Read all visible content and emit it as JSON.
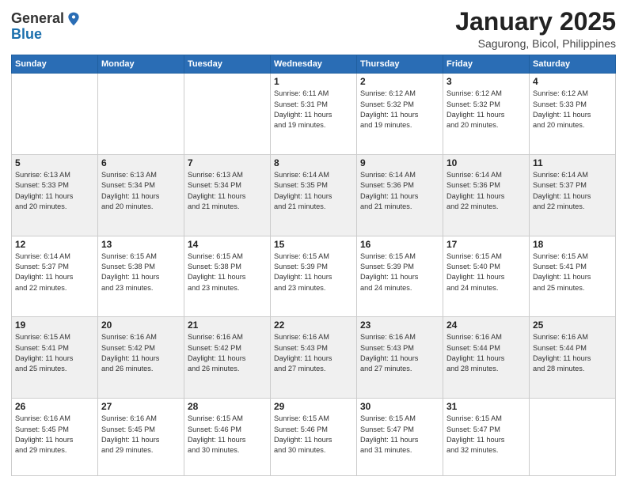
{
  "header": {
    "logo_general": "General",
    "logo_blue": "Blue",
    "month_title": "January 2025",
    "location": "Sagurong, Bicol, Philippines"
  },
  "days_of_week": [
    "Sunday",
    "Monday",
    "Tuesday",
    "Wednesday",
    "Thursday",
    "Friday",
    "Saturday"
  ],
  "weeks": [
    [
      {
        "day": "",
        "info": ""
      },
      {
        "day": "",
        "info": ""
      },
      {
        "day": "",
        "info": ""
      },
      {
        "day": "1",
        "info": "Sunrise: 6:11 AM\nSunset: 5:31 PM\nDaylight: 11 hours\nand 19 minutes."
      },
      {
        "day": "2",
        "info": "Sunrise: 6:12 AM\nSunset: 5:32 PM\nDaylight: 11 hours\nand 19 minutes."
      },
      {
        "day": "3",
        "info": "Sunrise: 6:12 AM\nSunset: 5:32 PM\nDaylight: 11 hours\nand 20 minutes."
      },
      {
        "day": "4",
        "info": "Sunrise: 6:12 AM\nSunset: 5:33 PM\nDaylight: 11 hours\nand 20 minutes."
      }
    ],
    [
      {
        "day": "5",
        "info": "Sunrise: 6:13 AM\nSunset: 5:33 PM\nDaylight: 11 hours\nand 20 minutes."
      },
      {
        "day": "6",
        "info": "Sunrise: 6:13 AM\nSunset: 5:34 PM\nDaylight: 11 hours\nand 20 minutes."
      },
      {
        "day": "7",
        "info": "Sunrise: 6:13 AM\nSunset: 5:34 PM\nDaylight: 11 hours\nand 21 minutes."
      },
      {
        "day": "8",
        "info": "Sunrise: 6:14 AM\nSunset: 5:35 PM\nDaylight: 11 hours\nand 21 minutes."
      },
      {
        "day": "9",
        "info": "Sunrise: 6:14 AM\nSunset: 5:36 PM\nDaylight: 11 hours\nand 21 minutes."
      },
      {
        "day": "10",
        "info": "Sunrise: 6:14 AM\nSunset: 5:36 PM\nDaylight: 11 hours\nand 22 minutes."
      },
      {
        "day": "11",
        "info": "Sunrise: 6:14 AM\nSunset: 5:37 PM\nDaylight: 11 hours\nand 22 minutes."
      }
    ],
    [
      {
        "day": "12",
        "info": "Sunrise: 6:14 AM\nSunset: 5:37 PM\nDaylight: 11 hours\nand 22 minutes."
      },
      {
        "day": "13",
        "info": "Sunrise: 6:15 AM\nSunset: 5:38 PM\nDaylight: 11 hours\nand 23 minutes."
      },
      {
        "day": "14",
        "info": "Sunrise: 6:15 AM\nSunset: 5:38 PM\nDaylight: 11 hours\nand 23 minutes."
      },
      {
        "day": "15",
        "info": "Sunrise: 6:15 AM\nSunset: 5:39 PM\nDaylight: 11 hours\nand 23 minutes."
      },
      {
        "day": "16",
        "info": "Sunrise: 6:15 AM\nSunset: 5:39 PM\nDaylight: 11 hours\nand 24 minutes."
      },
      {
        "day": "17",
        "info": "Sunrise: 6:15 AM\nSunset: 5:40 PM\nDaylight: 11 hours\nand 24 minutes."
      },
      {
        "day": "18",
        "info": "Sunrise: 6:15 AM\nSunset: 5:41 PM\nDaylight: 11 hours\nand 25 minutes."
      }
    ],
    [
      {
        "day": "19",
        "info": "Sunrise: 6:15 AM\nSunset: 5:41 PM\nDaylight: 11 hours\nand 25 minutes."
      },
      {
        "day": "20",
        "info": "Sunrise: 6:16 AM\nSunset: 5:42 PM\nDaylight: 11 hours\nand 26 minutes."
      },
      {
        "day": "21",
        "info": "Sunrise: 6:16 AM\nSunset: 5:42 PM\nDaylight: 11 hours\nand 26 minutes."
      },
      {
        "day": "22",
        "info": "Sunrise: 6:16 AM\nSunset: 5:43 PM\nDaylight: 11 hours\nand 27 minutes."
      },
      {
        "day": "23",
        "info": "Sunrise: 6:16 AM\nSunset: 5:43 PM\nDaylight: 11 hours\nand 27 minutes."
      },
      {
        "day": "24",
        "info": "Sunrise: 6:16 AM\nSunset: 5:44 PM\nDaylight: 11 hours\nand 28 minutes."
      },
      {
        "day": "25",
        "info": "Sunrise: 6:16 AM\nSunset: 5:44 PM\nDaylight: 11 hours\nand 28 minutes."
      }
    ],
    [
      {
        "day": "26",
        "info": "Sunrise: 6:16 AM\nSunset: 5:45 PM\nDaylight: 11 hours\nand 29 minutes."
      },
      {
        "day": "27",
        "info": "Sunrise: 6:16 AM\nSunset: 5:45 PM\nDaylight: 11 hours\nand 29 minutes."
      },
      {
        "day": "28",
        "info": "Sunrise: 6:15 AM\nSunset: 5:46 PM\nDaylight: 11 hours\nand 30 minutes."
      },
      {
        "day": "29",
        "info": "Sunrise: 6:15 AM\nSunset: 5:46 PM\nDaylight: 11 hours\nand 30 minutes."
      },
      {
        "day": "30",
        "info": "Sunrise: 6:15 AM\nSunset: 5:47 PM\nDaylight: 11 hours\nand 31 minutes."
      },
      {
        "day": "31",
        "info": "Sunrise: 6:15 AM\nSunset: 5:47 PM\nDaylight: 11 hours\nand 32 minutes."
      },
      {
        "day": "",
        "info": ""
      }
    ]
  ]
}
